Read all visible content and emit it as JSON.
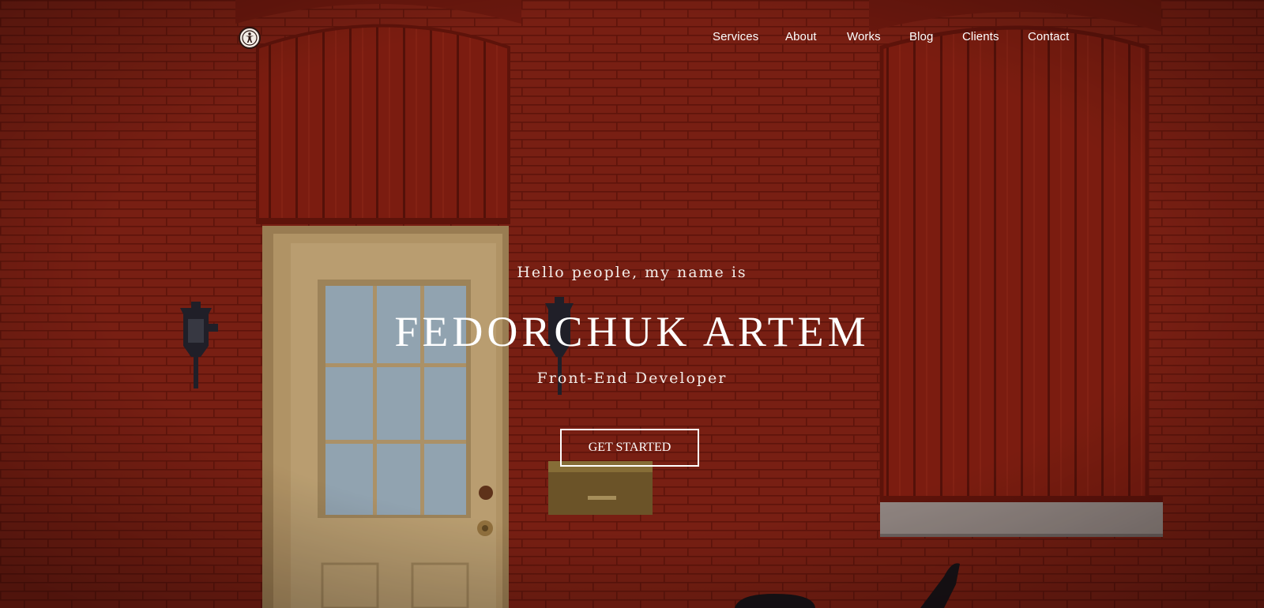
{
  "nav": {
    "items": [
      {
        "label": "Services"
      },
      {
        "label": "About"
      },
      {
        "label": "Works"
      },
      {
        "label": "Blog"
      },
      {
        "label": "Clients"
      },
      {
        "label": "Contact"
      }
    ]
  },
  "hero": {
    "greeting": "Hello people, my name is",
    "name": "FEDORCHUK ARTEM",
    "role": "Front-End Developer",
    "cta_label": "GET STARTED"
  },
  "icons": {
    "accessibility": "accessibility-icon"
  },
  "colors": {
    "brick": "#8b2416",
    "door": "#d9c08a",
    "text": "#ffffff"
  }
}
